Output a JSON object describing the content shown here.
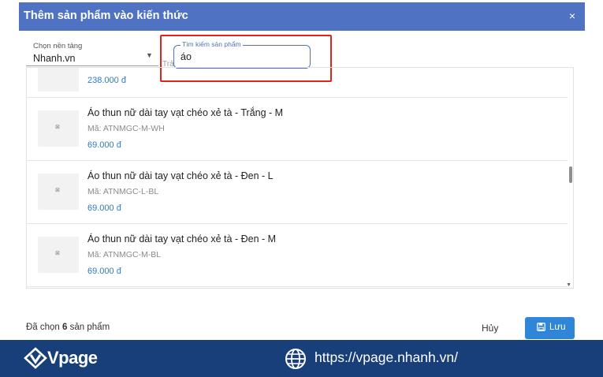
{
  "modal": {
    "title": "Thêm sản phẩm vào kiến thức",
    "close": "×"
  },
  "platform": {
    "label": "Chọn nền tảng",
    "value": "Nhanh.vn",
    "hidden_label": "Trả"
  },
  "search": {
    "label": "Tìm kiếm sản phẩm",
    "value": "áo"
  },
  "products": [
    {
      "name": "",
      "code": "",
      "price": "238.000 đ"
    },
    {
      "name": "Áo thun nữ dài tay vạt chéo xẻ tà - Trắng - M",
      "code": "Mã: ATNMGC-M-WH",
      "price": "69.000 đ"
    },
    {
      "name": "Áo thun nữ dài tay vạt chéo xẻ tà - Đen - L",
      "code": "Mã: ATNMGC-L-BL",
      "price": "69.000 đ"
    },
    {
      "name": "Áo thun nữ dài tay vạt chéo xẻ tà - Đen - M",
      "code": "Mã: ATNMGC-M-BL",
      "price": "69.000 đ"
    }
  ],
  "footer": {
    "selected_prefix": "Đã chọn",
    "selected_count": "6",
    "selected_suffix": "sản phẩm",
    "cancel_label": "Hủy",
    "save_label": "Lưu"
  },
  "brand": {
    "logo_text": "Vpage",
    "url": "https://vpage.nhanh.vn/"
  },
  "colors": {
    "header": "#4f73c2",
    "price": "#2d7ac7",
    "save_button": "#2f86d8",
    "brand_bar": "#183f7a",
    "highlight": "#e0231c"
  },
  "icons": {
    "close": "close-icon",
    "caret": "caret-down-icon",
    "save": "floppy-disk-icon",
    "logo": "vpage-logo-icon",
    "globe": "globe-icon",
    "thumb": "image-placeholder-icon"
  }
}
